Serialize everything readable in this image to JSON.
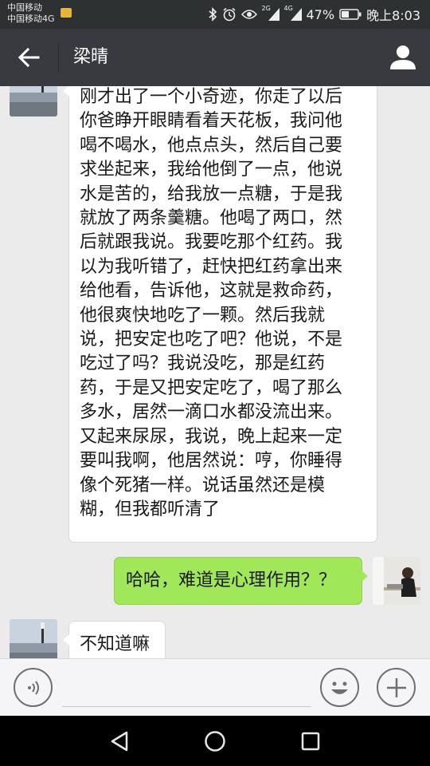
{
  "status_bar": {
    "carrier1": "中国移动",
    "carrier2": "中国移动4G",
    "signal1_label": "2G",
    "signal2_label": "4G",
    "battery": "47%",
    "time": "晚上8:03",
    "icons": [
      "mail-icon",
      "bluetooth-icon",
      "alarm-icon",
      "eye-icon",
      "signal-icon",
      "battery-icon"
    ]
  },
  "header": {
    "title": "梁晴",
    "back_icon": "back-arrow-icon",
    "profile_icon": "person-icon",
    "bg_color": "#393a3f"
  },
  "messages": [
    {
      "side": "left",
      "lines": [
        "刚才出了一个小奇迹，你走了以后",
        "你爸睁开眼睛看着天花板，我问他",
        "喝不喝水，他点点头，然后自己要",
        "求坐起来，我给他倒了一点，他说",
        "水是苦的，给我放一点糖，于是我",
        "就放了两条羹糖。他喝了两口，然",
        "后就跟我说。我要吃那个红药。我",
        "以为我听错了，赶快把红药拿出来",
        "给他看，告诉他，这就是救命药，",
        "他很爽快地吃了一颗。然后我就",
        "说，把安定也吃了吧？他说，不是",
        "吃过了吗？我说没吃，那是红药",
        "药，于是又把安定吃了，喝了那么",
        "多水，居然一滴口水都没流出来。",
        "又起来尿尿，我说，晚上起来一定",
        "要叫我啊，他居然说：哼，你睡得",
        "像个死猪一样。说话虽然还是模",
        "糊，但我都听清了"
      ]
    },
    {
      "side": "right",
      "text": "哈哈，难道是心理作用？？"
    },
    {
      "side": "left",
      "text": "不知道嘛"
    }
  ],
  "colors": {
    "chat_bg": "#ebebeb",
    "bubble_left": "#ffffff",
    "bubble_right": "#a0e759"
  },
  "input_bar": {
    "voice_icon": "voice-icon",
    "emoji_icon": "emoji-icon",
    "plus_icon": "plus-icon",
    "text_value": ""
  },
  "nav_bar": {
    "icons": [
      "nav-back-icon",
      "nav-home-icon",
      "nav-recents-icon"
    ]
  }
}
